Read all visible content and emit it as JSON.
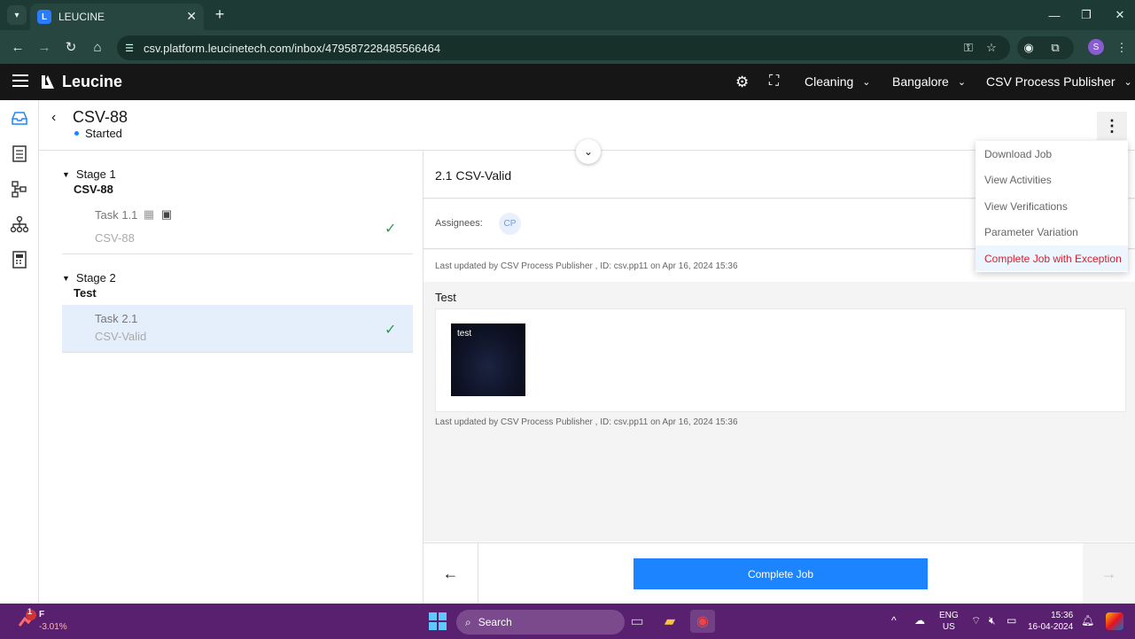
{
  "browser": {
    "tab_title": "LEUCINE",
    "url": "csv.platform.leucinetech.com/inbox/479587228485566464",
    "profile_initial": "S"
  },
  "header": {
    "brand": "Leucine",
    "module": "Cleaning",
    "facility": "Bangalore",
    "role": "CSV Process Publisher"
  },
  "job": {
    "title": "CSV-88",
    "status": "Started"
  },
  "stages": [
    {
      "label": "Stage 1",
      "name": "CSV-88",
      "task": {
        "label": "Task 1.1",
        "name": "CSV-88"
      }
    },
    {
      "label": "Stage 2",
      "name": "Test",
      "task": {
        "label": "Task 2.1",
        "name": "CSV-Valid"
      }
    }
  ],
  "task_panel": {
    "title": "2.1 CSV-Valid",
    "assignees_label": "Assignees:",
    "assignee_initials": "CP",
    "last_updated_1": "Last updated by CSV Process Publisher , ID: csv.pp11 on Apr 16, 2024 15:36",
    "section_label": "Test",
    "media_caption": "test",
    "last_updated_2": "Last updated by CSV Process Publisher , ID: csv.pp11 on Apr 16, 2024 15:36"
  },
  "footer": {
    "complete_label": "Complete Job"
  },
  "menu": {
    "items": [
      "Download Job",
      "View Activities",
      "View Verifications",
      "Parameter Variation",
      "Complete Job with Exception"
    ]
  },
  "taskbar": {
    "stock_label": "F",
    "stock_change": "-3.01%",
    "notification_count": "1",
    "search_label": "Search",
    "lang_line1": "ENG",
    "lang_line2": "US",
    "time": "15:36",
    "date": "16-04-2024"
  },
  "colors": {
    "accent": "#1d84ff",
    "danger": "#da1e28",
    "success": "#24a148",
    "header_bg": "#161616",
    "browser_bg": "#1d3a34",
    "taskbar_bg": "#5a2070"
  }
}
